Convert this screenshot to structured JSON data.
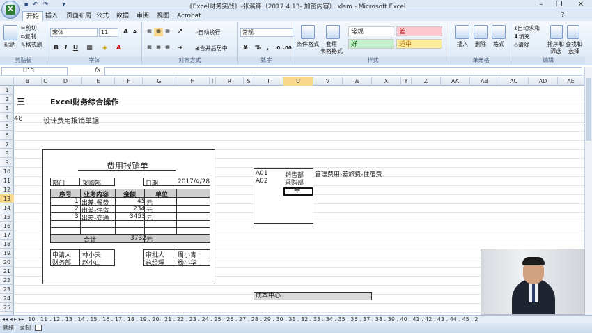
{
  "window": {
    "title": "《Excel财务实战》-张溪锋（2017.4.13- 加密内容）.xlsm - Microsoft Excel",
    "quick_access": [
      "save-icon",
      "undo-icon",
      "redo-icon",
      "customize-icon"
    ]
  },
  "ribbon_tabs": [
    "开始",
    "插入",
    "页面布局",
    "公式",
    "数据",
    "审阅",
    "视图",
    "Acrobat"
  ],
  "ribbon": {
    "clipboard": {
      "paste": "粘贴",
      "cut": "剪切",
      "copy": "复制",
      "format_painter": "格式刷",
      "label": "剪贴板"
    },
    "font": {
      "name": "宋体",
      "size": "11",
      "label": "字体",
      "bold": "B",
      "italic": "I",
      "underline": "U",
      "grow": "A",
      "shrink": "A"
    },
    "alignment": {
      "wrap": "自动换行",
      "merge": "合并后居中",
      "label": "对齐方式"
    },
    "number": {
      "format": "常规",
      "label": "数字",
      "percent": "%",
      "comma": ","
    },
    "styles": {
      "conditional": "条件格式",
      "table": "套用\n表格格式",
      "cells": [
        "常规",
        "差",
        "好",
        "适中"
      ],
      "label": "样式"
    },
    "cells": {
      "insert": "插入",
      "delete": "删除",
      "format": "格式",
      "label": "单元格"
    },
    "editing": {
      "autosum": "自动求和",
      "fill": "填充",
      "clear": "清除",
      "sort": "排序和\n筛选",
      "find": "查找和\n选择",
      "label": "编辑"
    }
  },
  "formula_bar": {
    "name_box": "U13",
    "fx": "fx",
    "value": ""
  },
  "columns": [
    "B",
    "C",
    "D",
    "E",
    "F",
    "G",
    "H",
    "I",
    "R",
    "S",
    "T",
    "U",
    "V",
    "W",
    "X",
    "Y",
    "Z",
    "AA",
    "AB",
    "AC",
    "AD",
    "AE"
  ],
  "selected_column": "U",
  "rows": [
    "1",
    "2",
    "3",
    "4",
    "5",
    "6",
    "7",
    "8",
    "9",
    "10",
    "11",
    "12",
    "13",
    "14",
    "15",
    "16",
    "17",
    "18",
    "19",
    "20",
    "21",
    "22",
    "23",
    "24",
    "25"
  ],
  "selected_row": "13",
  "sheet": {
    "heading_num": "三",
    "heading": "Excel财务综合操作",
    "sub_num": "48",
    "sub_title": "设计费用报销单据",
    "form": {
      "title": "费用报销单",
      "dept_label": "部门",
      "dept_value": "采购部",
      "date_label": "日期",
      "date_value": "2017/4/28",
      "headers": [
        "序号",
        "业务内容",
        "金额",
        "单位"
      ],
      "rows": [
        {
          "no": "1",
          "desc": "出差-餐费",
          "amount": "45",
          "unit": "元"
        },
        {
          "no": "2",
          "desc": "出差-住宿",
          "amount": "234",
          "unit": "元"
        },
        {
          "no": "3",
          "desc": "出差-交通",
          "amount": "3453",
          "unit": "元"
        }
      ],
      "total_label": "合计",
      "total_value": "3732",
      "total_unit": "元",
      "applicant_label": "申请人",
      "applicant": "林小天",
      "approver_label": "审批人",
      "approver": "周小青",
      "finance_label": "财务部",
      "finance": "赵小山",
      "manager_label": "总经理",
      "manager": "杨小华"
    },
    "lookup": [
      {
        "code": "A01",
        "dept": "销售部"
      },
      {
        "code": "A02",
        "dept": "采购部"
      }
    ],
    "note": "管理费用-差旅费-住宿费",
    "cost_center": "成本中心"
  },
  "sheet_tabs": "10 . 11 . 12 . 13 . 14 . 15 . 16 . 17 . 18 . 19 . 20 . 21 . 22 . 23 . 24 . 25 . 26 . 27 . 28 . 29 . 30 . 31 . 32 . 33 . 34 . 35 . 36 . 37 . 38 . 39 . 40 . 41 . 42 . 43 . 44 . 45 . 2",
  "status": {
    "ready": "就绪",
    "record": "录制"
  }
}
